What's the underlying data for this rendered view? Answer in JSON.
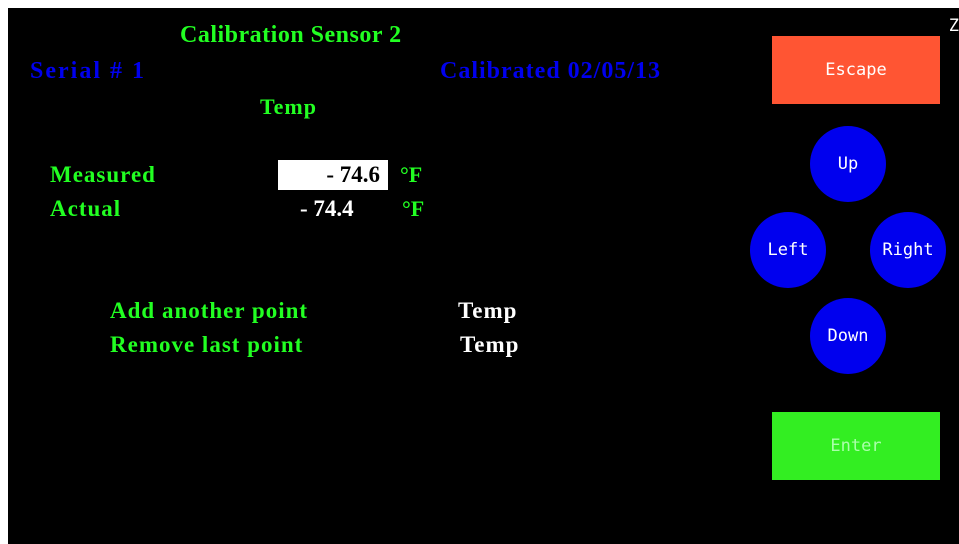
{
  "header": {
    "title": "Calibration Sensor 2",
    "serial": "Serial # 1",
    "calibrated": "Calibrated 02/05/13",
    "sensor_type": "Temp",
    "corner_text": "Z"
  },
  "readings": {
    "measured_label": "Measured",
    "measured_value": "- 74.6",
    "actual_label": "Actual",
    "actual_value": "- 74.4",
    "unit": "°F"
  },
  "points": {
    "add_label": "Add another point",
    "add_value": "Temp",
    "remove_label": "Remove last point",
    "remove_value": "Temp"
  },
  "controls": {
    "escape": "Escape",
    "up": "Up",
    "left": "Left",
    "right": "Right",
    "down": "Down",
    "enter": "Enter"
  },
  "colors": {
    "background": "#000000",
    "label_green": "#22ff22",
    "info_blue": "#0000ee",
    "escape_button": "#ff5533",
    "enter_button": "#33ee22",
    "nav_button": "#0000ee"
  }
}
